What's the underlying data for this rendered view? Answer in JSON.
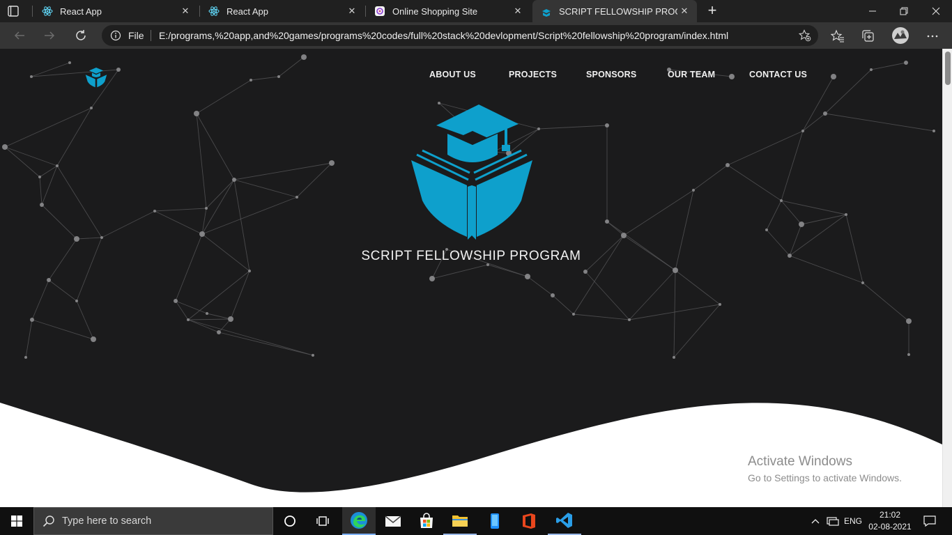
{
  "browser": {
    "tabs": [
      {
        "label": "React App",
        "icon": "react-icon",
        "active": false
      },
      {
        "label": "React App",
        "icon": "react-icon",
        "active": false
      },
      {
        "label": "Online Shopping Site",
        "icon": "site-icon",
        "active": false
      },
      {
        "label": "SCRIPT FELLOWSHIP PROGRAM",
        "icon": "fellowship-logo-icon",
        "active": true
      }
    ],
    "close_glyph": "✕",
    "new_tab_glyph": "+",
    "address": {
      "scheme_label": "File",
      "url": "E:/programs,%20app,and%20games/programs%20codes/full%20stack%20devlopment/Script%20fellowship%20program/index.html"
    }
  },
  "page": {
    "nav": {
      "about": "ABOUT US",
      "projects": "PROJECTS",
      "sponsors": "SPONSORS",
      "team": "OUR TEAM",
      "contact": "CONTACT US"
    },
    "hero_title": "SCRIPT FELLOWSHIP PROGRAM",
    "accent_color": "#0ea0cc",
    "background_color": "#1b1b1c"
  },
  "watermark": {
    "line1": "Activate Windows",
    "line2": "Go to Settings to activate Windows."
  },
  "taskbar": {
    "search_placeholder": "Type here to search",
    "language": "ENG",
    "time": "21:02",
    "date": "02-08-2021"
  }
}
